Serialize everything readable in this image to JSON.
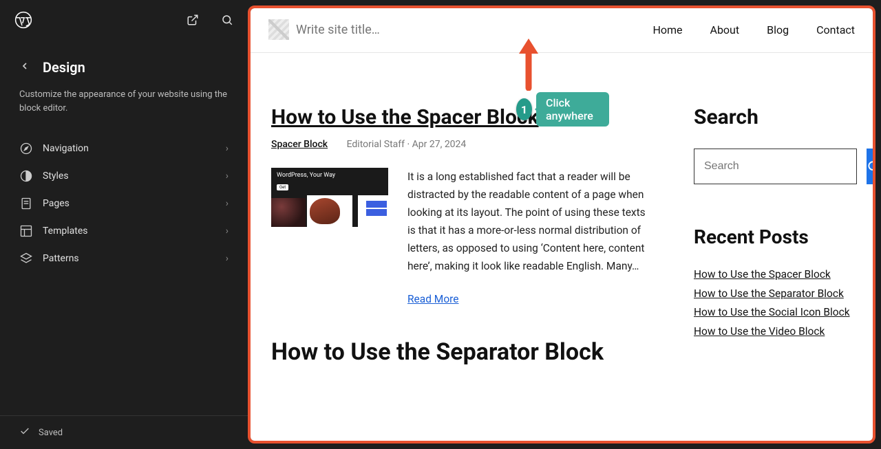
{
  "sidebar": {
    "title": "Design",
    "description": "Customize the appearance of your website using the block editor.",
    "items": [
      {
        "label": "Navigation",
        "icon": "compass"
      },
      {
        "label": "Styles",
        "icon": "contrast"
      },
      {
        "label": "Pages",
        "icon": "page"
      },
      {
        "label": "Templates",
        "icon": "layout"
      },
      {
        "label": "Patterns",
        "icon": "patterns"
      }
    ],
    "saved": "Saved"
  },
  "site": {
    "title_placeholder": "Write site title…",
    "nav": [
      "Home",
      "About",
      "Blog",
      "Contact"
    ]
  },
  "posts": [
    {
      "title": "How to Use the Spacer Block",
      "category": "Spacer Block",
      "author": "Editorial Staff",
      "date": "Apr 27, 2024",
      "thumb_headline": "WordPress, Your Way",
      "excerpt": "It is a long established fact that a reader will be distracted by the readable content of a page when looking at its layout. The point of using these texts is that it has a more-or-less normal distribution of letters, as opposed to using ‘Content here, content here’, making it look like readable English. Many…",
      "read_more": "Read More"
    },
    {
      "title": "How to Use the Separator Block"
    }
  ],
  "aside": {
    "search_heading": "Search",
    "search_placeholder": "Search",
    "recent_heading": "Recent Posts",
    "recent": [
      "How to Use the Spacer Block",
      "How to Use the Separator Block",
      "How to Use the Social Icon Block",
      "How to Use the Video Block"
    ]
  },
  "annotation": {
    "step": "1",
    "label": "Click anywhere"
  }
}
